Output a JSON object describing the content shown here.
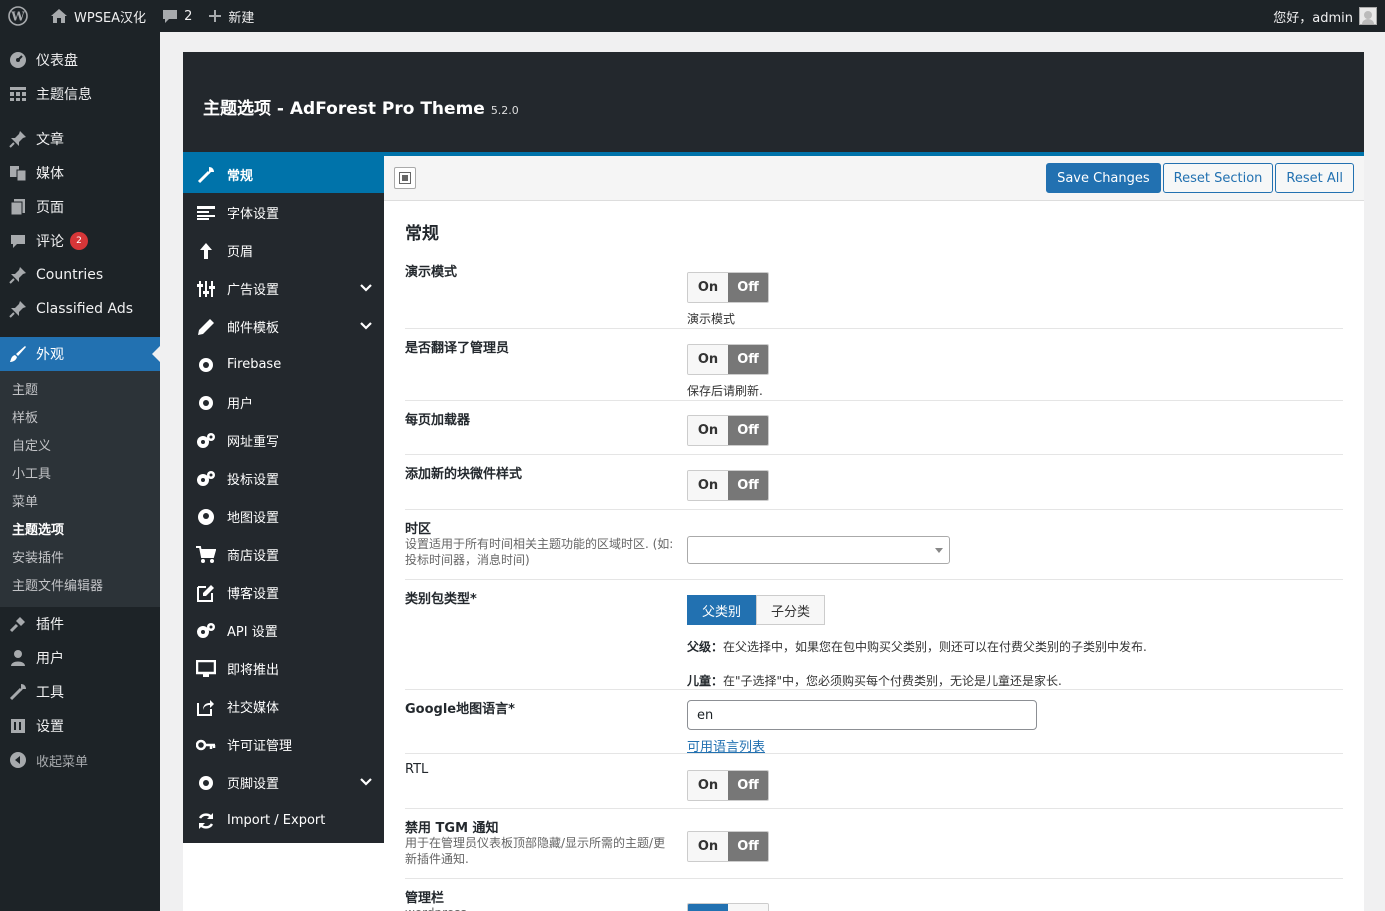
{
  "adminbar": {
    "site_name": "WPSEA汉化",
    "comments_count": "2",
    "new_label": "新建",
    "greeting": "您好，admin"
  },
  "menu": {
    "dashboard": "仪表盘",
    "theme_info": "主题信息",
    "posts": "文章",
    "media": "媒体",
    "pages": "页面",
    "comments": "评论",
    "comments_badge": "2",
    "countries": "Countries",
    "classified_ads": "Classified Ads",
    "appearance": "外观",
    "appearance_sub": [
      "主题",
      "样板",
      "自定义",
      "小工具",
      "菜单",
      "主题选项",
      "安装插件",
      "主题文件编辑器"
    ],
    "plugins": "插件",
    "users": "用户",
    "tools": "工具",
    "settings": "设置",
    "collapse": "收起菜单"
  },
  "redux": {
    "title": "主题选项 - AdForest Pro Theme",
    "version": "5.2.0",
    "sidebar": [
      {
        "label": "常规",
        "icon": "wrench-icon",
        "active": true
      },
      {
        "label": "字体设置",
        "icon": "text-lines-icon"
      },
      {
        "label": "页眉",
        "icon": "arrow-up-icon"
      },
      {
        "label": "广告设置",
        "icon": "sliders-icon",
        "chevron": true
      },
      {
        "label": "邮件模板",
        "icon": "pencil-icon",
        "chevron": true
      },
      {
        "label": "Firebase",
        "icon": "gear-icon"
      },
      {
        "label": "用户",
        "icon": "gear-icon"
      },
      {
        "label": "网址重写",
        "icon": "gears-icon"
      },
      {
        "label": "投标设置",
        "icon": "gears-icon"
      },
      {
        "label": "地图设置",
        "icon": "map-pin-icon"
      },
      {
        "label": "商店设置",
        "icon": "cart-icon"
      },
      {
        "label": "博客设置",
        "icon": "edit-icon"
      },
      {
        "label": "API 设置",
        "icon": "gears-icon"
      },
      {
        "label": "即将推出",
        "icon": "monitor-icon"
      },
      {
        "label": "社交媒体",
        "icon": "share-icon"
      },
      {
        "label": "许可证管理",
        "icon": "key-icon"
      },
      {
        "label": "页脚设置",
        "icon": "gear-icon",
        "chevron": true
      },
      {
        "label": "Import / Export",
        "icon": "refresh-icon"
      }
    ],
    "toolbar": {
      "save": "Save Changes",
      "reset_section": "Reset Section",
      "reset_all": "Reset All"
    },
    "section_title": "常规",
    "on": "On",
    "off": "Off",
    "fields": {
      "demo_mode": {
        "label": "演示模式",
        "note": "演示模式"
      },
      "translated_admin": {
        "label": "是否翻译了管理员",
        "note": "保存后请刷新."
      },
      "page_loader": {
        "label": "每页加载器"
      },
      "block_widget": {
        "label": "添加新的块微件样式"
      },
      "timezone": {
        "label": "时区",
        "desc": "设置适用于所有时间相关主题功能的区域时区. (如:投标时间器，消息时间)"
      },
      "category_package": {
        "label": "类别包类型*",
        "opt_parent": "父类别",
        "opt_child": "子分类",
        "parent_title": "父级：",
        "parent_text": "在父选择中，如果您在包中购买父类别，则还可以在付费父类别的子类别中发布.",
        "child_title": "儿童：",
        "child_text": "在\"子选择\"中，您必须购买每个付费类别，无论是儿童还是家长."
      },
      "google_map_lang": {
        "label": "Google地图语言*",
        "value": "en",
        "link": "可用语言列表"
      },
      "rtl": {
        "label": "RTL"
      },
      "disable_tgm": {
        "label": "禁用 TGM 通知",
        "desc": "用于在管理员仪表板顶部隐藏/显示所需的主题/更新插件通知."
      },
      "admin_bar": {
        "label": "管理栏",
        "desc": "wordpress"
      }
    }
  }
}
